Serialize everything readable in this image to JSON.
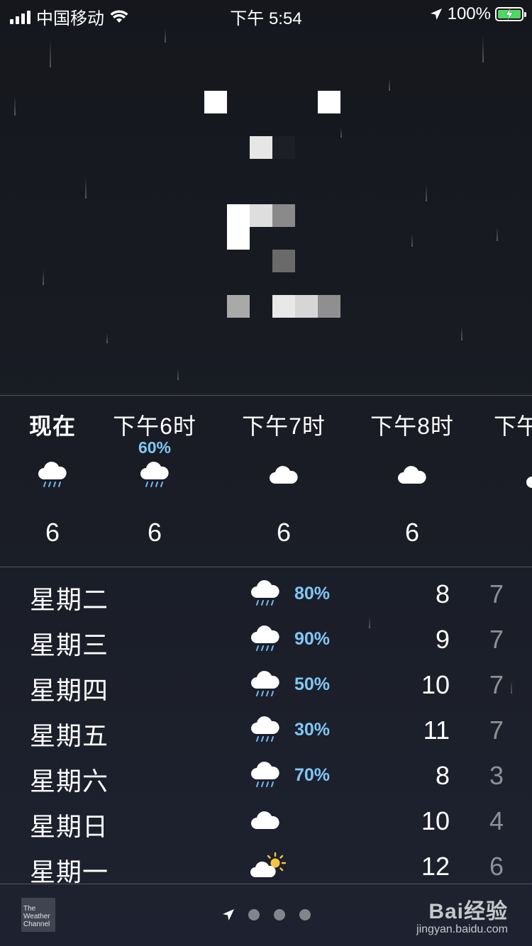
{
  "status_bar": {
    "carrier": "中国移动",
    "time": "下午 5:54",
    "battery": "100%"
  },
  "hourly": [
    {
      "label": "现在",
      "pop": "",
      "icon": "rain-cloud-icon",
      "temp": "6"
    },
    {
      "label": "下午6时",
      "pop": "60%",
      "icon": "rain-cloud-icon",
      "temp": "6"
    },
    {
      "label": "下午7时",
      "pop": "",
      "icon": "cloud-icon",
      "temp": "6"
    },
    {
      "label": "下午8时",
      "pop": "",
      "icon": "cloud-icon",
      "temp": "6"
    },
    {
      "label": "下午",
      "pop": "",
      "icon": "cloud-icon",
      "temp": ""
    }
  ],
  "daily": [
    {
      "day": "星期二",
      "icon": "rain-cloud-icon",
      "pop": "80%",
      "high": "8",
      "low": "7"
    },
    {
      "day": "星期三",
      "icon": "rain-cloud-icon",
      "pop": "90%",
      "high": "9",
      "low": "7"
    },
    {
      "day": "星期四",
      "icon": "rain-cloud-icon",
      "pop": "50%",
      "high": "10",
      "low": "7"
    },
    {
      "day": "星期五",
      "icon": "rain-cloud-icon",
      "pop": "30%",
      "high": "11",
      "low": "7"
    },
    {
      "day": "星期六",
      "icon": "rain-cloud-icon",
      "pop": "70%",
      "high": "8",
      "low": "3"
    },
    {
      "day": "星期日",
      "icon": "cloud-icon",
      "pop": "",
      "high": "10",
      "low": "4"
    },
    {
      "day": "星期一",
      "icon": "partly-sunny-icon",
      "pop": "",
      "high": "12",
      "low": "6"
    }
  ],
  "footer": {
    "provider": "The Weather Channel",
    "watermark_title": "Bai经验",
    "watermark_url": "jingyan.baidu.com"
  },
  "colors": {
    "pop_blue": "#7fc7f6",
    "battery_green": "#4cd964",
    "background": "#191c24"
  }
}
